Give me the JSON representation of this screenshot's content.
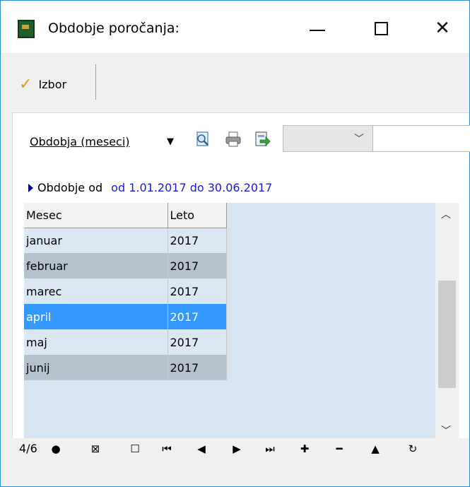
{
  "window": {
    "title": "Obdobje poročanja:",
    "controls": {
      "minimize": "—",
      "maximize": "☐",
      "close": "✕"
    }
  },
  "toolbar": {
    "izbor_label": "Izbor",
    "izbor_icon": "checkmark-icon"
  },
  "filter": {
    "period_label": "Obdobja (meseci)",
    "period_dropdown_icon": "caret-down-icon",
    "tools": [
      "print-preview-icon",
      "print-icon",
      "export-icon"
    ],
    "combo_value": "",
    "search_value": ""
  },
  "range": {
    "label": "Obdobje od",
    "value": "od 1.01.2017 do 30.06.2017"
  },
  "grid": {
    "columns": [
      "Mesec",
      "Leto"
    ],
    "rows": [
      {
        "month": "januar",
        "year": "2017",
        "state": "normal"
      },
      {
        "month": "februar",
        "year": "2017",
        "state": "alt"
      },
      {
        "month": "marec",
        "year": "2017",
        "state": "normal"
      },
      {
        "month": "april",
        "year": "2017",
        "state": "selected"
      },
      {
        "month": "maj",
        "year": "2017",
        "state": "normal"
      },
      {
        "month": "junij",
        "year": "2017",
        "state": "alt"
      }
    ]
  },
  "navigator": {
    "position": "4/6",
    "buttons": [
      {
        "name": "mark-all-icon",
        "glyph": "●"
      },
      {
        "name": "toggle-mark-icon",
        "glyph": "⊠"
      },
      {
        "name": "unmark-icon",
        "glyph": "☐"
      },
      {
        "name": "first-record-icon",
        "glyph": "⏮"
      },
      {
        "name": "prev-record-icon",
        "glyph": "◀"
      },
      {
        "name": "next-record-icon",
        "glyph": "▶"
      },
      {
        "name": "last-record-icon",
        "glyph": "⏭"
      },
      {
        "name": "add-record-icon",
        "glyph": "✚"
      },
      {
        "name": "delete-record-icon",
        "glyph": "━"
      },
      {
        "name": "move-up-icon",
        "glyph": "▲"
      },
      {
        "name": "refresh-icon",
        "glyph": "↻"
      }
    ]
  },
  "colors": {
    "selection": "#3399ff",
    "grid_background": "#d7e5f2",
    "row_alt": "#b5c2ce",
    "range_value": "#1a1adb",
    "window_border": "#2a8dd4"
  }
}
